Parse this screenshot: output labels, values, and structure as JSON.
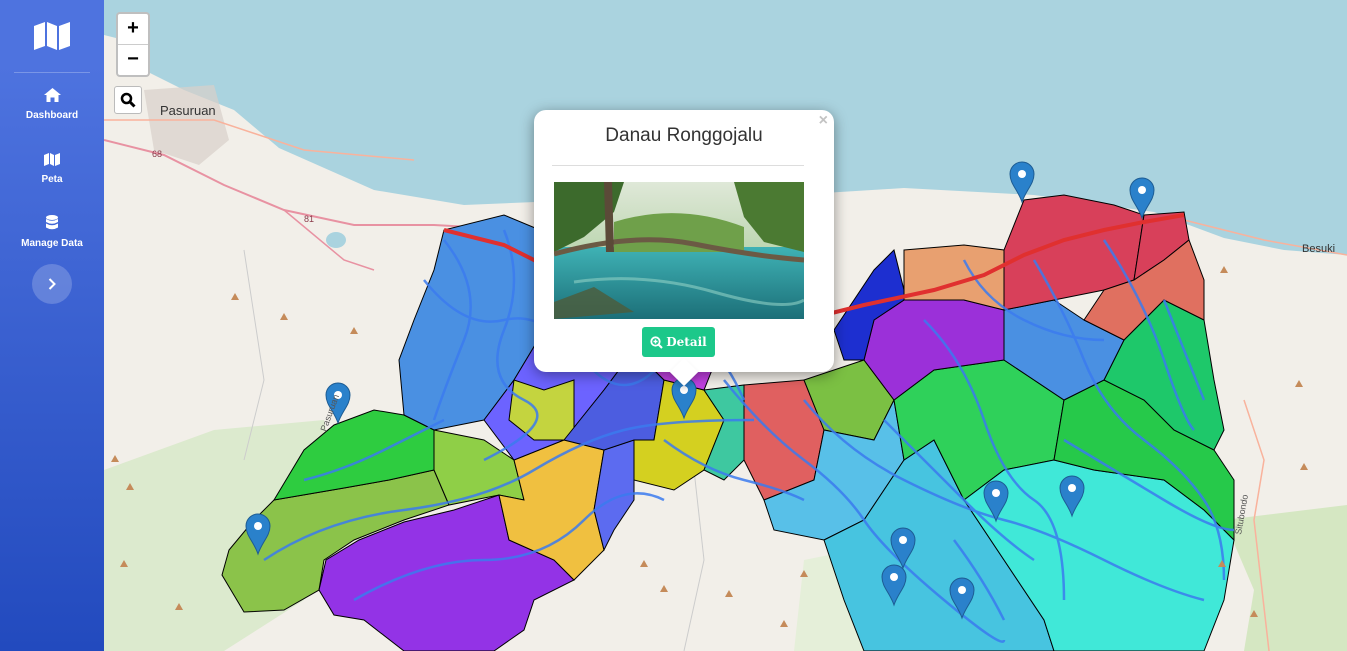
{
  "sidebar": {
    "brand_icon": "map-icon",
    "items": [
      {
        "label": "Dashboard",
        "icon": "home-icon"
      },
      {
        "label": "Peta",
        "icon": "map-icon"
      },
      {
        "label": "Manage Data",
        "icon": "database-icon"
      }
    ],
    "toggle_icon": "chevron-right-icon"
  },
  "map": {
    "zoom_in": "+",
    "zoom_out": "−",
    "search_icon": "search-icon",
    "labels": {
      "city": "Pasuruan",
      "road_68": "68",
      "road_81": "81",
      "besuki": "Besuki",
      "situbondo": "Situbondo",
      "pasuruan_road": "Pasuruan"
    },
    "marker_icon": "map-marker-icon",
    "marker_count": 10
  },
  "popup": {
    "title": "Danau Ronggojalu",
    "close": "×",
    "detail_label": "Detail",
    "detail_icon": "search-plus-icon"
  },
  "colors": {
    "sidebar_top": "#4e73df",
    "sidebar_bottom": "#224abe",
    "detail_button": "#1cc88a",
    "sea": "#aad3df",
    "land": "#f2efe9"
  }
}
